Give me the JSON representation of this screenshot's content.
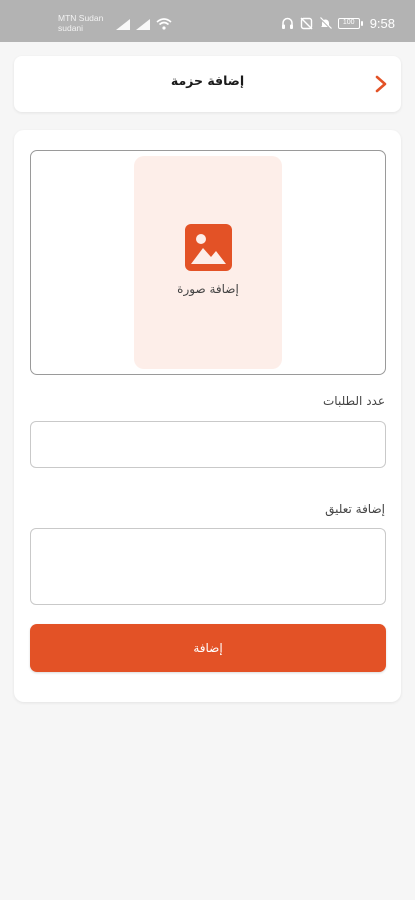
{
  "status_bar": {
    "carrier_name": "MTN Sudan",
    "carrier_sub": "sudani",
    "time": "9:58",
    "battery_level": "100"
  },
  "header": {
    "title": "إضافة حزمة"
  },
  "image_picker": {
    "label": "إضافة صورة"
  },
  "form": {
    "orders_count_label": "عدد الطلبات",
    "orders_count_value": "",
    "comment_label": "إضافة تعليق",
    "comment_value": "",
    "submit_label": "إضافة"
  },
  "colors": {
    "accent": "#e35226",
    "picker_bg": "#fdeee9",
    "status_bar_bg": "#b3b3b3",
    "page_bg": "#f6f6f6"
  },
  "icons": [
    "cell-signal-icon",
    "wifi-icon",
    "headphones-icon",
    "alarm-off-icon",
    "mute-icon",
    "battery-icon",
    "chevron-right-icon",
    "image-icon"
  ]
}
